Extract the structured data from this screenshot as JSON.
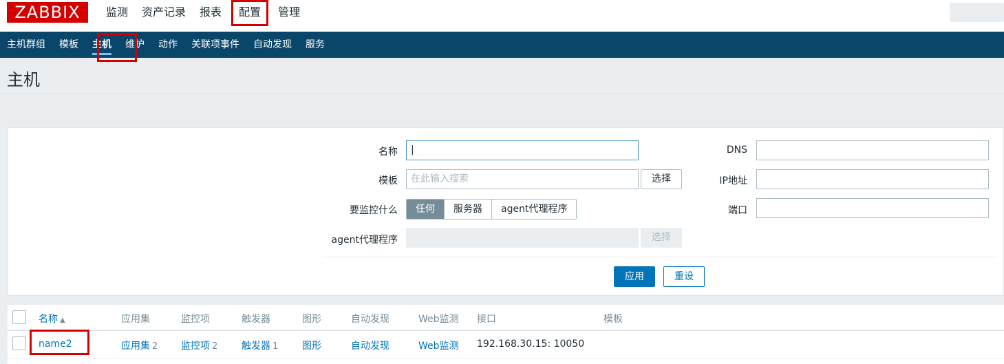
{
  "top": {
    "logo": "ZABBIX",
    "nav": [
      "监测",
      "资产记录",
      "报表",
      "配置",
      "管理"
    ],
    "active_nav": "配置"
  },
  "subnav": [
    "主机群组",
    "模板",
    "主机",
    "维护",
    "动作",
    "关联项事件",
    "自动发现",
    "服务"
  ],
  "active_subnav": "主机",
  "page_title": "主机",
  "filter": {
    "name_label": "名称",
    "name_value": "",
    "template_label": "模板",
    "template_placeholder": "在此输入搜索",
    "select_button": "选择",
    "monitored_by_label": "要监控什么",
    "monitored_by_options": [
      "任何",
      "服务器",
      "agent代理程序"
    ],
    "monitored_by_selected": "任何",
    "proxy_label": "agent代理程序",
    "proxy_select_button": "选择",
    "dns_label": "DNS",
    "ip_label": "IP地址",
    "port_label": "端口",
    "apply_button": "应用",
    "reset_button": "重设"
  },
  "table": {
    "columns": [
      "名称",
      "应用集",
      "监控项",
      "触发器",
      "图形",
      "自动发现",
      "Web监测",
      "接口",
      "模板"
    ],
    "sort_icon": "▲",
    "rows": [
      {
        "name": "name2",
        "applications": "应用集",
        "applications_count": "2",
        "items": "监控项",
        "items_count": "2",
        "triggers": "触发器",
        "triggers_count": "1",
        "graphs": "图形",
        "discovery": "自动发现",
        "web": "Web监测",
        "interface": "192.168.30.15: 10050",
        "templates": ""
      }
    ]
  },
  "colors": {
    "brand_red": "#d40000",
    "subnav_bg": "#0a466a",
    "link": "#0275b8",
    "highlight_box": "#d40000"
  }
}
